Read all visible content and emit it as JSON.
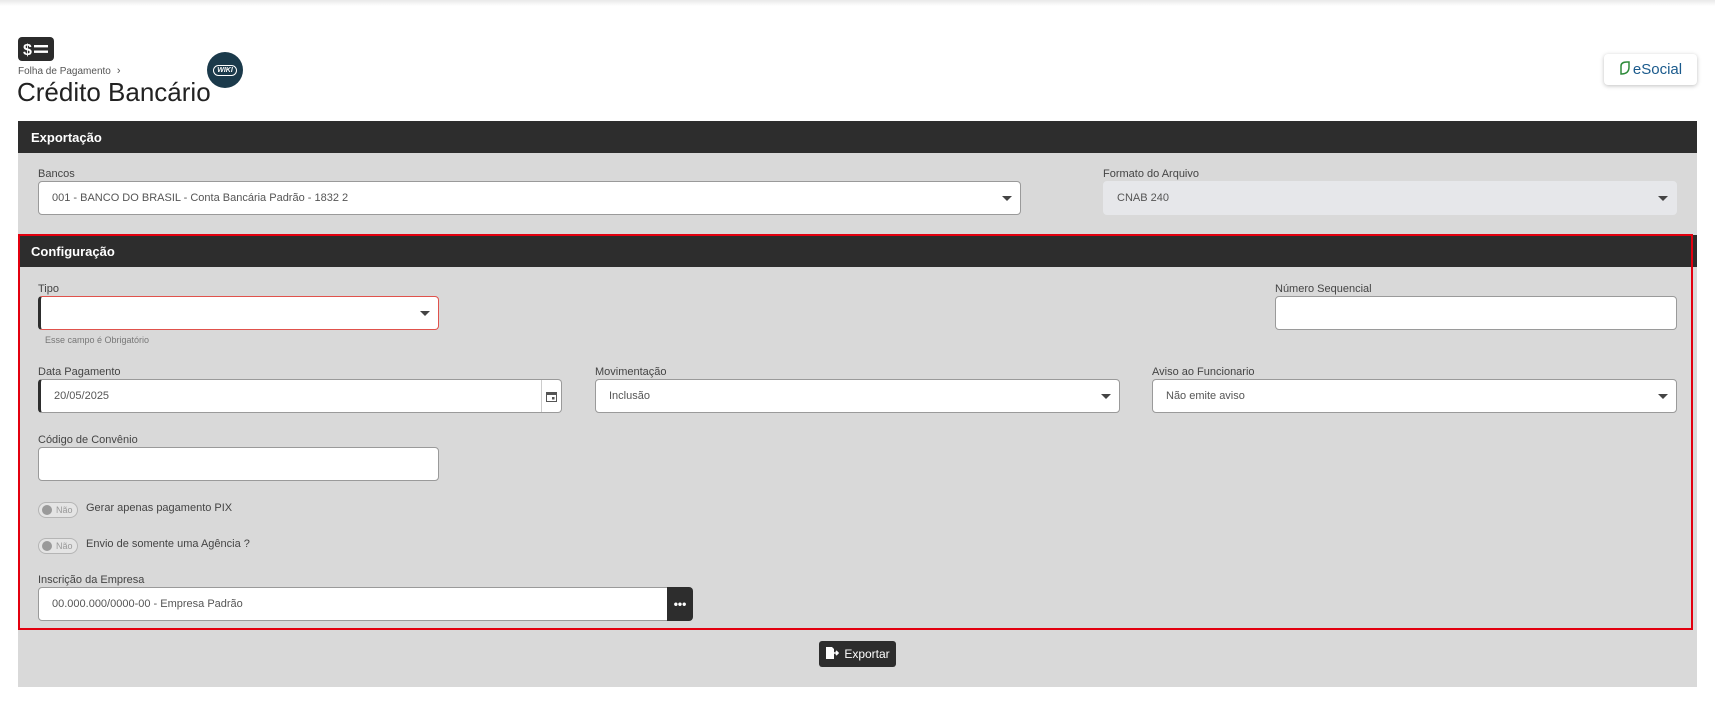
{
  "header": {
    "breadcrumb_parent": "Folha de Pagamento",
    "breadcrumb_separator": "›",
    "title": "Crédito Bancário",
    "wiki_label": "WIKI",
    "esocial_label": "eSocial"
  },
  "export_section": {
    "title": "Exportação",
    "bancos_label": "Bancos",
    "bancos_value": "001 - BANCO DO BRASIL - Conta Bancária Padrão - 1832 2",
    "formato_label": "Formato do Arquivo",
    "formato_value": "CNAB 240"
  },
  "config_section": {
    "title": "Configuração",
    "tipo_label": "Tipo",
    "tipo_value": "",
    "tipo_error": "Esse campo é Obrigatório",
    "numero_label": "Número Sequencial",
    "numero_value": "",
    "data_label": "Data Pagamento",
    "data_value": "20/05/2025",
    "movimentacao_label": "Movimentação",
    "movimentacao_value": "Inclusão",
    "aviso_label": "Aviso ao Funcionario",
    "aviso_value": "Não emite aviso",
    "convenio_label": "Código de Convênio",
    "convenio_value": "",
    "pix_toggle_state": "Não",
    "pix_label": "Gerar apenas pagamento PIX",
    "agencia_toggle_state": "Não",
    "agencia_label": "Envio de somente uma Agência ?",
    "inscricao_label": "Inscrição da Empresa",
    "inscricao_value": "00.000.000/0000-00 - Empresa Padrão",
    "lookup_glyph": "•••"
  },
  "actions": {
    "export_label": "Exportar"
  },
  "colors": {
    "header_bar": "#2d2d2d",
    "panel_bg": "#d9d9d9",
    "highlight_outline": "#e3000f",
    "error_border": "#e0524c"
  }
}
